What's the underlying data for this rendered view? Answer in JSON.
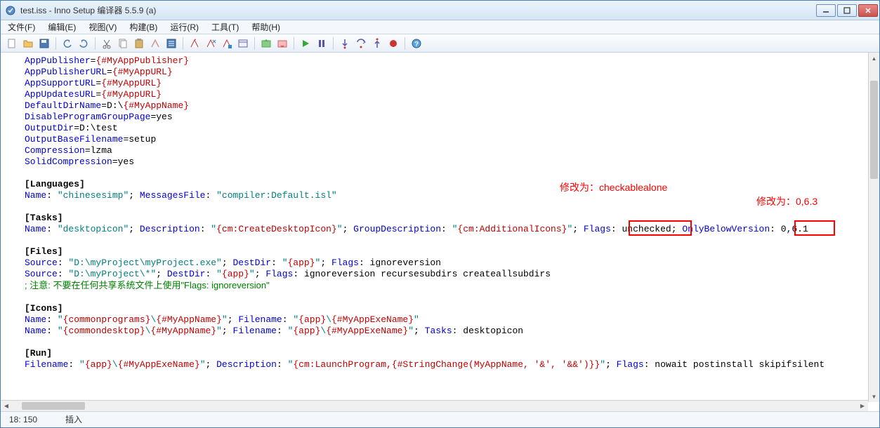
{
  "window": {
    "title": "test.iss - Inno Setup 编译器 5.5.9 (a)"
  },
  "menu": {
    "file": "文件(F)",
    "edit": "编辑(E)",
    "view": "视图(V)",
    "build": "构建(B)",
    "run": "运行(R)",
    "tools": "工具(T)",
    "help": "帮助(H)"
  },
  "annotations": {
    "annot1": "修改为：checkablealone",
    "annot2": "修改为：0,6.3"
  },
  "code": {
    "l1a": "AppPublisher",
    "l1b": "=",
    "l1c": "{#MyAppPublisher}",
    "l2a": "AppPublisherURL",
    "l2b": "=",
    "l2c": "{#MyAppURL}",
    "l3a": "AppSupportURL",
    "l3b": "=",
    "l3c": "{#MyAppURL}",
    "l4a": "AppUpdatesURL",
    "l4b": "=",
    "l4c": "{#MyAppURL}",
    "l5a": "DefaultDirName",
    "l5b": "=D:\\",
    "l5c": "{#MyAppName}",
    "l6a": "DisableProgramGroupPage",
    "l6b": "=yes",
    "l7a": "OutputDir",
    "l7b": "=D:\\test",
    "l8a": "OutputBaseFilename",
    "l8b": "=setup",
    "l9a": "Compression",
    "l9b": "=lzma",
    "l10a": "SolidCompression",
    "l10b": "=yes",
    "sec_lang": "[Languages]",
    "l12a": "Name",
    "l12b": ": ",
    "l12c": "\"chinesesimp\"",
    "l12d": "; ",
    "l12e": "MessagesFile",
    "l12f": ": ",
    "l12g": "\"compiler:Default.isl\"",
    "sec_tasks": "[Tasks]",
    "l14a": "Name",
    "l14b": ": ",
    "l14c": "\"desktopicon\"",
    "l14d": "; ",
    "l14e": "Description",
    "l14f": ": ",
    "l14g": "\"",
    "l14h": "{cm:CreateDesktopIcon}",
    "l14i": "\"",
    "l14j": "; ",
    "l14k": "GroupDescription",
    "l14l": ": ",
    "l14m": "\"",
    "l14n": "{cm:AdditionalIcons}",
    "l14o": "\"",
    "l14p": "; ",
    "l14q": "Flags",
    "l14r": ": ",
    "l14s": "unchecked; ",
    "l14t": "OnlyBelowVersion",
    "l14u": ": ",
    "l14v": "0,6.1",
    "sec_files": "[Files]",
    "l16a": "Source",
    "l16b": ": ",
    "l16c": "\"D:\\myProject\\myProject.exe\"",
    "l16d": "; ",
    "l16e": "DestDir",
    "l16f": ": ",
    "l16g": "\"",
    "l16h": "{app}",
    "l16i": "\"",
    "l16j": "; ",
    "l16k": "Flags",
    "l16l": ": ignoreversion",
    "l17a": "Source",
    "l17b": ": ",
    "l17c": "\"D:\\myProject\\*\"",
    "l17d": "; ",
    "l17e": "DestDir",
    "l17f": ": ",
    "l17g": "\"",
    "l17h": "{app}",
    "l17i": "\"",
    "l17j": "; ",
    "l17k": "Flags",
    "l17l": ": ignoreversion recursesubdirs createallsubdirs",
    "l18": "; 注意: 不要在任何共享系统文件上使用\"Flags: ignoreversion\"",
    "sec_icons": "[Icons]",
    "l20a": "Name",
    "l20b": ": ",
    "l20c": "\"",
    "l20d": "{commonprograms}",
    "l20e": "\\",
    "l20f": "{#MyAppName}",
    "l20g": "\"",
    "l20h": "; ",
    "l20i": "Filename",
    "l20j": ": ",
    "l20k": "\"",
    "l20l": "{app}",
    "l20m": "\\",
    "l20n": "{#MyAppExeName}",
    "l20o": "\"",
    "l21a": "Name",
    "l21b": ": ",
    "l21c": "\"",
    "l21d": "{commondesktop}",
    "l21e": "\\",
    "l21f": "{#MyAppName}",
    "l21g": "\"",
    "l21h": "; ",
    "l21i": "Filename",
    "l21j": ": ",
    "l21k": "\"",
    "l21l": "{app}",
    "l21m": "\\",
    "l21n": "{#MyAppExeName}",
    "l21o": "\"",
    "l21p": "; ",
    "l21q": "Tasks",
    "l21r": ": desktopicon",
    "sec_run": "[Run]",
    "l23a": "Filename",
    "l23b": ": ",
    "l23c": "\"",
    "l23d": "{app}",
    "l23e": "\\",
    "l23f": "{#MyAppExeName}",
    "l23g": "\"",
    "l23h": "; ",
    "l23i": "Description",
    "l23j": ": ",
    "l23k": "\"",
    "l23l": "{cm:LaunchProgram,{#StringChange(MyAppName, '&', '&&')}}",
    "l23m": "\"",
    "l23n": "; ",
    "l23o": "Flags",
    "l23p": ": nowait postinstall skipifsilent"
  },
  "status": {
    "pos": "18: 150",
    "mode": "插入"
  }
}
